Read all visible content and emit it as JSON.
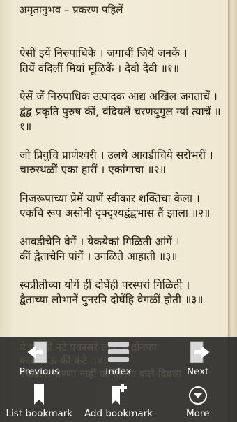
{
  "header": {
    "title": "अमृतानुभव – प्रकरण पहिलें"
  },
  "verses": [
    "ऐसीं इयें निरुपाधिकें । जगाचीं जियें जनकें ।\nतियें वंदिलीं मियां मूळिकें । देवो देवी ॥१॥",
    "ऐसें जें निरुपाधिक उत्पादक आद्य अखिल जगताचें ।\nद्वंद्व प्रकृति पुरुष कीं, वंदियलें चरणयुगुल ग्यां त्याचें ॥१॥",
    "जो प्रियुचि प्राणेश्वरी । उलथे आवडीचिये सरोभरीं ।\nचारुस्थळीं एका हारीं । एकांगाचा ॥२॥",
    "निजरूपाच्या प्रेमें याणें स्वीकार शक्तिचा केला ।\nएकचि रूप असोनी दृक्दृश्यद्वंद्वभास तैं झाला ॥२॥",
    "आवडीचेनि वेगें । येकयेकां गिळिती आंगें ।\nकीं द्वैताचेनि पांगें । उगळिते आहाती ॥३॥",
    "स्वप्रीतीच्या योगें हीं दोघेंही परस्परां गिळिती ।\nद्वैताच्या लोभानें पुनरपि दोघेंहि वेगळीं होती ॥३॥"
  ],
  "ghost_text": "ये धुकमीं नटे एकासरें लोपीनि दोनपण\nकाय ठाऊ कीं कंटे ॥४॥\nएकवल्लभीण्णा नाहीं जागीनिमा कले दिवसा",
  "toolbar": {
    "previous": "Previous",
    "index": "Index",
    "next": "Next",
    "list_bookmark": "List bookmark",
    "add_bookmark": "Add bookmark",
    "more": "More"
  }
}
